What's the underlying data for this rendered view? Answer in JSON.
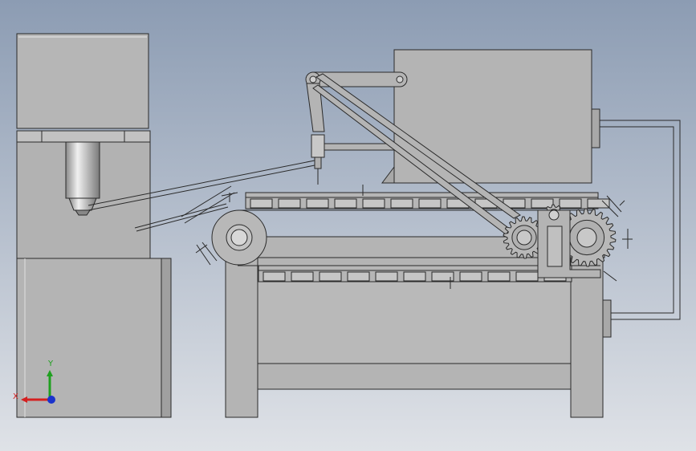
{
  "viewport": {
    "background_top": "#8c9cb3",
    "background_bottom": "#dfe2e7"
  },
  "colors": {
    "part_fill": "#b4b4b4",
    "part_fill_dark": "#9e9e9e",
    "part_fill_light": "#c6c6c6",
    "edge": "#2a2a2a",
    "shaft_highlight": "#e8e8e8"
  },
  "triad": {
    "x_label": "X",
    "y_label": "Y",
    "x_color": "#d42020",
    "y_color": "#1fa01f",
    "z_color": "#1a33cc"
  },
  "parts": {
    "press_machine": "press-machine",
    "conveyor": "chain-conveyor",
    "hopper": "hopper-box",
    "linkage": "drive-linkage"
  }
}
